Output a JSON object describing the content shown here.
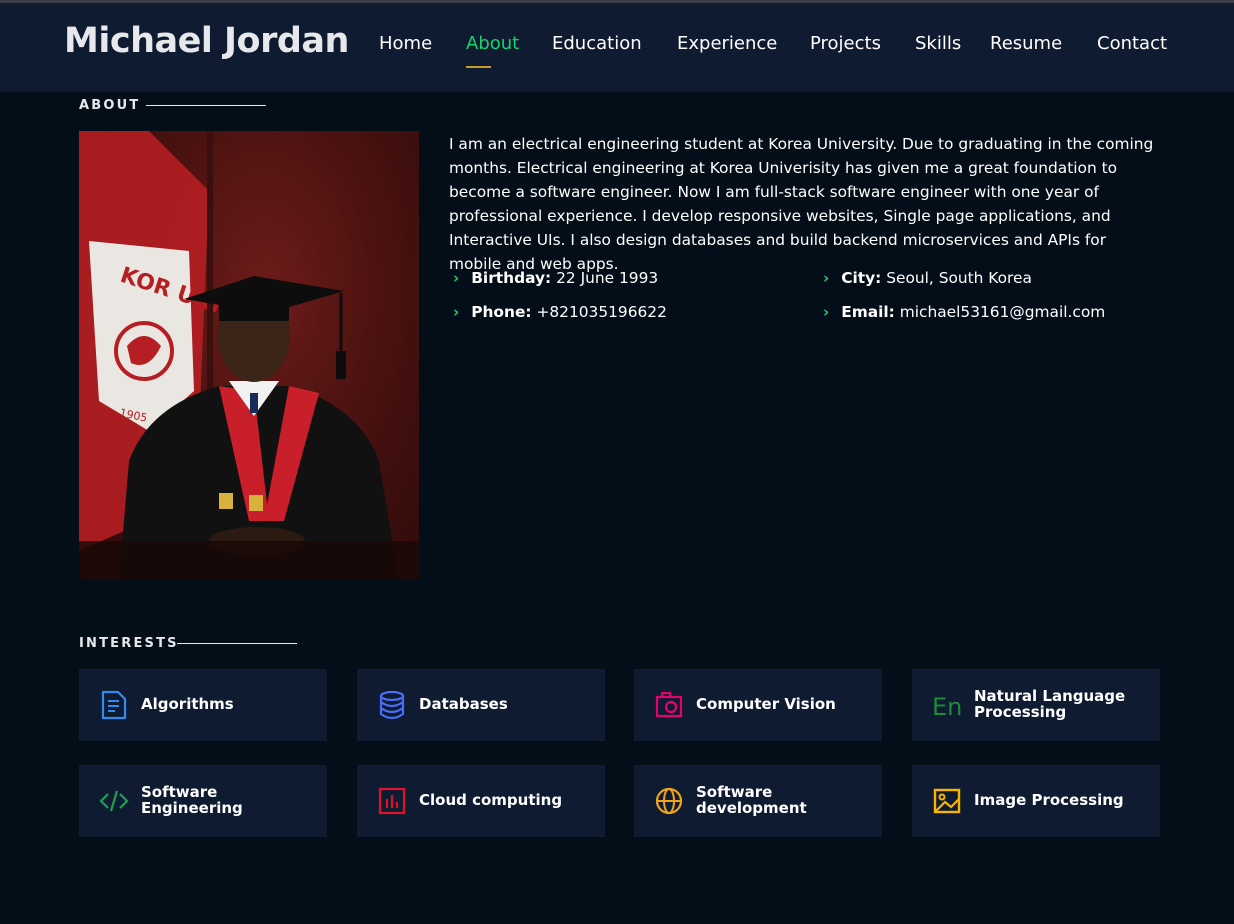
{
  "brand": {
    "name": "Michael Jordan"
  },
  "nav": {
    "items": [
      "Home",
      "About",
      "Education",
      "Experience",
      "Projects",
      "Skills",
      "Resume",
      "Contact"
    ],
    "active": "About"
  },
  "about": {
    "section_title": "ABOUT",
    "bio": "I am an electrical engineering student at Korea University. Due to graduating in the coming months. Electrical engineering at Korea Univerisity has given me a great foundation to become a software engineer. Now I am full-stack software engineer with one year of professional experience. I develop responsive websites, Single page applications, and Interactive UIs. I also design databases and build backend microservices and APIs for mobile and web apps.",
    "details": [
      {
        "label": "Birthday:",
        "value": "22 June 1993"
      },
      {
        "label": "City:",
        "value": "Seoul, South Korea"
      },
      {
        "label": "Phone:",
        "value": "+821035196622"
      },
      {
        "label": "Email:",
        "value": "michael53161@gmail.com"
      }
    ],
    "photo": {
      "flag_text": "KOR UNIVER",
      "year": "1905"
    }
  },
  "interests": {
    "section_title": "INTERESTS",
    "items": [
      {
        "label": "Algorithms",
        "icon": "document-icon",
        "color": "#2f8cf0"
      },
      {
        "label": "Databases",
        "icon": "database-icon",
        "color": "#4a6cf7"
      },
      {
        "label": "Computer Vision",
        "icon": "camera-icon",
        "color": "#e5006d"
      },
      {
        "label": "Natural Language Processing",
        "icon": "language-icon",
        "color": "#1e8a3a"
      },
      {
        "label": "Software Engineering",
        "icon": "code-icon",
        "color": "#1f9d55"
      },
      {
        "label": "Cloud computing",
        "icon": "bar-chart-icon",
        "color": "#e0112b"
      },
      {
        "label": "Software development",
        "icon": "globe-icon",
        "color": "#f0a418"
      },
      {
        "label": "Image Processing",
        "icon": "image-icon",
        "color": "#f7b500"
      }
    ]
  }
}
